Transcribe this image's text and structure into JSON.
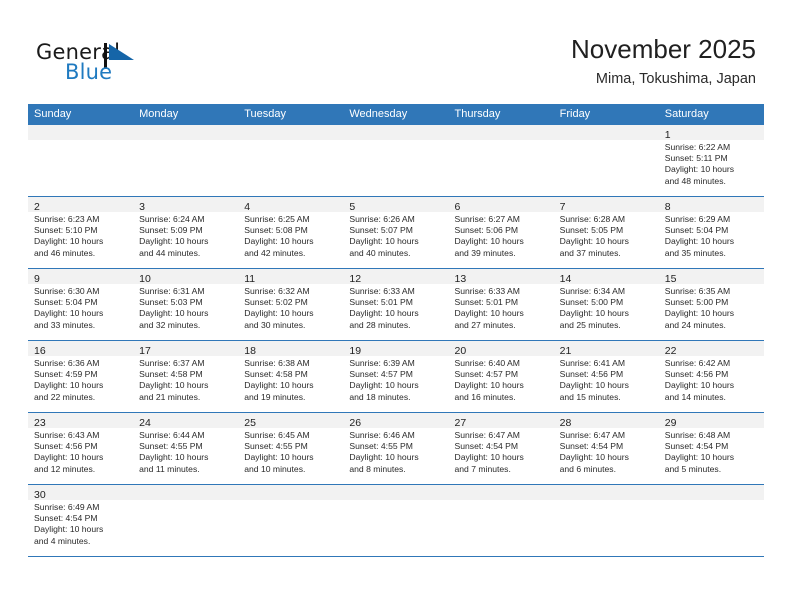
{
  "brand": {
    "name_part1": "General",
    "name_part2": "Blue",
    "mark": "triangle-logo",
    "color": "#1f7ac0"
  },
  "header": {
    "title": "November 2025",
    "subtitle": "Mima, Tokushima, Japan"
  },
  "theme": {
    "header_blue": "#3077b8",
    "day_band_gray": "#f2f2f2",
    "text": "#2a2a2a"
  },
  "weekday_headers": [
    "Sunday",
    "Monday",
    "Tuesday",
    "Wednesday",
    "Thursday",
    "Friday",
    "Saturday"
  ],
  "weeks": [
    [
      {
        "day": "",
        "sunrise": "",
        "sunset": "",
        "daylight_line1": "",
        "daylight_line2": "",
        "empty": true
      },
      {
        "day": "",
        "sunrise": "",
        "sunset": "",
        "daylight_line1": "",
        "daylight_line2": "",
        "empty": true
      },
      {
        "day": "",
        "sunrise": "",
        "sunset": "",
        "daylight_line1": "",
        "daylight_line2": "",
        "empty": true
      },
      {
        "day": "",
        "sunrise": "",
        "sunset": "",
        "daylight_line1": "",
        "daylight_line2": "",
        "empty": true
      },
      {
        "day": "",
        "sunrise": "",
        "sunset": "",
        "daylight_line1": "",
        "daylight_line2": "",
        "empty": true
      },
      {
        "day": "",
        "sunrise": "",
        "sunset": "",
        "daylight_line1": "",
        "daylight_line2": "",
        "empty": true
      },
      {
        "day": "1",
        "sunrise": "Sunrise: 6:22 AM",
        "sunset": "Sunset: 5:11 PM",
        "daylight_line1": "Daylight: 10 hours",
        "daylight_line2": "and 48 minutes.",
        "empty": false
      }
    ],
    [
      {
        "day": "2",
        "sunrise": "Sunrise: 6:23 AM",
        "sunset": "Sunset: 5:10 PM",
        "daylight_line1": "Daylight: 10 hours",
        "daylight_line2": "and 46 minutes.",
        "empty": false
      },
      {
        "day": "3",
        "sunrise": "Sunrise: 6:24 AM",
        "sunset": "Sunset: 5:09 PM",
        "daylight_line1": "Daylight: 10 hours",
        "daylight_line2": "and 44 minutes.",
        "empty": false
      },
      {
        "day": "4",
        "sunrise": "Sunrise: 6:25 AM",
        "sunset": "Sunset: 5:08 PM",
        "daylight_line1": "Daylight: 10 hours",
        "daylight_line2": "and 42 minutes.",
        "empty": false
      },
      {
        "day": "5",
        "sunrise": "Sunrise: 6:26 AM",
        "sunset": "Sunset: 5:07 PM",
        "daylight_line1": "Daylight: 10 hours",
        "daylight_line2": "and 40 minutes.",
        "empty": false
      },
      {
        "day": "6",
        "sunrise": "Sunrise: 6:27 AM",
        "sunset": "Sunset: 5:06 PM",
        "daylight_line1": "Daylight: 10 hours",
        "daylight_line2": "and 39 minutes.",
        "empty": false
      },
      {
        "day": "7",
        "sunrise": "Sunrise: 6:28 AM",
        "sunset": "Sunset: 5:05 PM",
        "daylight_line1": "Daylight: 10 hours",
        "daylight_line2": "and 37 minutes.",
        "empty": false
      },
      {
        "day": "8",
        "sunrise": "Sunrise: 6:29 AM",
        "sunset": "Sunset: 5:04 PM",
        "daylight_line1": "Daylight: 10 hours",
        "daylight_line2": "and 35 minutes.",
        "empty": false
      }
    ],
    [
      {
        "day": "9",
        "sunrise": "Sunrise: 6:30 AM",
        "sunset": "Sunset: 5:04 PM",
        "daylight_line1": "Daylight: 10 hours",
        "daylight_line2": "and 33 minutes.",
        "empty": false
      },
      {
        "day": "10",
        "sunrise": "Sunrise: 6:31 AM",
        "sunset": "Sunset: 5:03 PM",
        "daylight_line1": "Daylight: 10 hours",
        "daylight_line2": "and 32 minutes.",
        "empty": false
      },
      {
        "day": "11",
        "sunrise": "Sunrise: 6:32 AM",
        "sunset": "Sunset: 5:02 PM",
        "daylight_line1": "Daylight: 10 hours",
        "daylight_line2": "and 30 minutes.",
        "empty": false
      },
      {
        "day": "12",
        "sunrise": "Sunrise: 6:33 AM",
        "sunset": "Sunset: 5:01 PM",
        "daylight_line1": "Daylight: 10 hours",
        "daylight_line2": "and 28 minutes.",
        "empty": false
      },
      {
        "day": "13",
        "sunrise": "Sunrise: 6:33 AM",
        "sunset": "Sunset: 5:01 PM",
        "daylight_line1": "Daylight: 10 hours",
        "daylight_line2": "and 27 minutes.",
        "empty": false
      },
      {
        "day": "14",
        "sunrise": "Sunrise: 6:34 AM",
        "sunset": "Sunset: 5:00 PM",
        "daylight_line1": "Daylight: 10 hours",
        "daylight_line2": "and 25 minutes.",
        "empty": false
      },
      {
        "day": "15",
        "sunrise": "Sunrise: 6:35 AM",
        "sunset": "Sunset: 5:00 PM",
        "daylight_line1": "Daylight: 10 hours",
        "daylight_line2": "and 24 minutes.",
        "empty": false
      }
    ],
    [
      {
        "day": "16",
        "sunrise": "Sunrise: 6:36 AM",
        "sunset": "Sunset: 4:59 PM",
        "daylight_line1": "Daylight: 10 hours",
        "daylight_line2": "and 22 minutes.",
        "empty": false
      },
      {
        "day": "17",
        "sunrise": "Sunrise: 6:37 AM",
        "sunset": "Sunset: 4:58 PM",
        "daylight_line1": "Daylight: 10 hours",
        "daylight_line2": "and 21 minutes.",
        "empty": false
      },
      {
        "day": "18",
        "sunrise": "Sunrise: 6:38 AM",
        "sunset": "Sunset: 4:58 PM",
        "daylight_line1": "Daylight: 10 hours",
        "daylight_line2": "and 19 minutes.",
        "empty": false
      },
      {
        "day": "19",
        "sunrise": "Sunrise: 6:39 AM",
        "sunset": "Sunset: 4:57 PM",
        "daylight_line1": "Daylight: 10 hours",
        "daylight_line2": "and 18 minutes.",
        "empty": false
      },
      {
        "day": "20",
        "sunrise": "Sunrise: 6:40 AM",
        "sunset": "Sunset: 4:57 PM",
        "daylight_line1": "Daylight: 10 hours",
        "daylight_line2": "and 16 minutes.",
        "empty": false
      },
      {
        "day": "21",
        "sunrise": "Sunrise: 6:41 AM",
        "sunset": "Sunset: 4:56 PM",
        "daylight_line1": "Daylight: 10 hours",
        "daylight_line2": "and 15 minutes.",
        "empty": false
      },
      {
        "day": "22",
        "sunrise": "Sunrise: 6:42 AM",
        "sunset": "Sunset: 4:56 PM",
        "daylight_line1": "Daylight: 10 hours",
        "daylight_line2": "and 14 minutes.",
        "empty": false
      }
    ],
    [
      {
        "day": "23",
        "sunrise": "Sunrise: 6:43 AM",
        "sunset": "Sunset: 4:56 PM",
        "daylight_line1": "Daylight: 10 hours",
        "daylight_line2": "and 12 minutes.",
        "empty": false
      },
      {
        "day": "24",
        "sunrise": "Sunrise: 6:44 AM",
        "sunset": "Sunset: 4:55 PM",
        "daylight_line1": "Daylight: 10 hours",
        "daylight_line2": "and 11 minutes.",
        "empty": false
      },
      {
        "day": "25",
        "sunrise": "Sunrise: 6:45 AM",
        "sunset": "Sunset: 4:55 PM",
        "daylight_line1": "Daylight: 10 hours",
        "daylight_line2": "and 10 minutes.",
        "empty": false
      },
      {
        "day": "26",
        "sunrise": "Sunrise: 6:46 AM",
        "sunset": "Sunset: 4:55 PM",
        "daylight_line1": "Daylight: 10 hours",
        "daylight_line2": "and 8 minutes.",
        "empty": false
      },
      {
        "day": "27",
        "sunrise": "Sunrise: 6:47 AM",
        "sunset": "Sunset: 4:54 PM",
        "daylight_line1": "Daylight: 10 hours",
        "daylight_line2": "and 7 minutes.",
        "empty": false
      },
      {
        "day": "28",
        "sunrise": "Sunrise: 6:47 AM",
        "sunset": "Sunset: 4:54 PM",
        "daylight_line1": "Daylight: 10 hours",
        "daylight_line2": "and 6 minutes.",
        "empty": false
      },
      {
        "day": "29",
        "sunrise": "Sunrise: 6:48 AM",
        "sunset": "Sunset: 4:54 PM",
        "daylight_line1": "Daylight: 10 hours",
        "daylight_line2": "and 5 minutes.",
        "empty": false
      }
    ],
    [
      {
        "day": "30",
        "sunrise": "Sunrise: 6:49 AM",
        "sunset": "Sunset: 4:54 PM",
        "daylight_line1": "Daylight: 10 hours",
        "daylight_line2": "and 4 minutes.",
        "empty": false
      },
      {
        "day": "",
        "sunrise": "",
        "sunset": "",
        "daylight_line1": "",
        "daylight_line2": "",
        "empty": true
      },
      {
        "day": "",
        "sunrise": "",
        "sunset": "",
        "daylight_line1": "",
        "daylight_line2": "",
        "empty": true
      },
      {
        "day": "",
        "sunrise": "",
        "sunset": "",
        "daylight_line1": "",
        "daylight_line2": "",
        "empty": true
      },
      {
        "day": "",
        "sunrise": "",
        "sunset": "",
        "daylight_line1": "",
        "daylight_line2": "",
        "empty": true
      },
      {
        "day": "",
        "sunrise": "",
        "sunset": "",
        "daylight_line1": "",
        "daylight_line2": "",
        "empty": true
      },
      {
        "day": "",
        "sunrise": "",
        "sunset": "",
        "daylight_line1": "",
        "daylight_line2": "",
        "empty": true
      }
    ]
  ]
}
